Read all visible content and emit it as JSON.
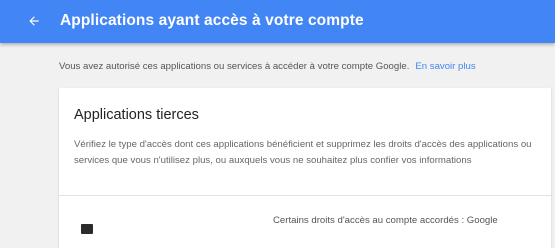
{
  "appbar": {
    "title": "Applications ayant accès à votre compte",
    "back_icon": "arrow-back-icon",
    "background": "#4285f4"
  },
  "intro": {
    "text": "Vous avez autorisé ces applications ou services à accéder à votre compte Google.",
    "link": "En savoir plus",
    "link_color": "#4285f4"
  },
  "third_party": {
    "title": "Applications tierces",
    "description": "Vérifiez le type d'accès dont ces applications bénéficient et supprimez les droits d'accès des applications ou services que vous n'utilisez plus, ou auxquels vous ne souhaitez plus confier vos informations",
    "items": [
      {
        "icon": "app-icon",
        "name": "",
        "detail": "Certains droits d'accès au compte accordés : Google"
      }
    ]
  }
}
